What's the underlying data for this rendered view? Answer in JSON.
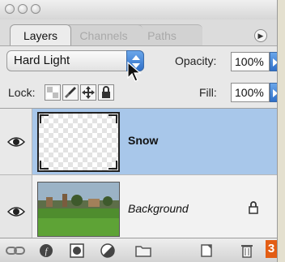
{
  "tabs": [
    {
      "label": "Layers",
      "active": true
    },
    {
      "label": "Channels",
      "active": false
    },
    {
      "label": "Paths",
      "active": false
    }
  ],
  "blend_mode": {
    "value": "Hard Light"
  },
  "opacity": {
    "label": "Opacity:",
    "value": "100%"
  },
  "lock": {
    "label": "Lock:"
  },
  "fill": {
    "label": "Fill:",
    "value": "100%"
  },
  "layers": [
    {
      "name": "Snow",
      "selected": true,
      "visible": true,
      "icon": "transparency-thumbnail"
    },
    {
      "name": "Background",
      "selected": false,
      "visible": true,
      "locked": true,
      "icon": "landscape-thumbnail"
    }
  ],
  "badge": {
    "text": "3"
  },
  "colors": {
    "selection": "#a8c7ea",
    "accent_blue": "#2f6fc8",
    "badge": "#e35d14"
  }
}
